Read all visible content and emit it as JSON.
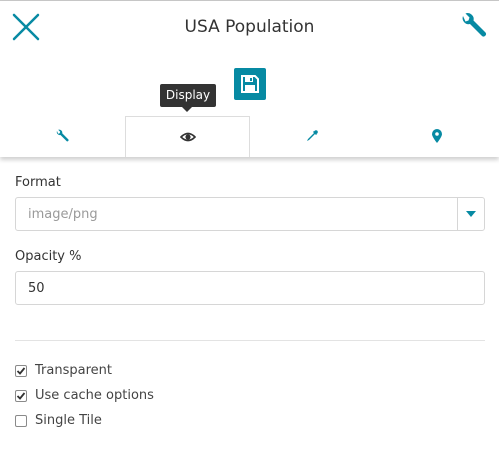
{
  "header": {
    "title": "USA Population",
    "close_icon": "close-icon",
    "settings_icon": "wrench-icon"
  },
  "toolbar": {
    "save_icon": "floppy-disk-icon",
    "tooltip": "Display"
  },
  "tabs": [
    {
      "icon": "wrench-icon",
      "active": false
    },
    {
      "icon": "eye-icon",
      "active": true
    },
    {
      "icon": "eyedropper-icon",
      "active": false
    },
    {
      "icon": "map-marker-icon",
      "active": false
    }
  ],
  "form": {
    "format_label": "Format",
    "format_value": "image/png",
    "opacity_label": "Opacity %",
    "opacity_value": "50"
  },
  "options": [
    {
      "label": "Transparent",
      "checked": true
    },
    {
      "label": "Use cache options",
      "checked": true
    },
    {
      "label": "Single Tile",
      "checked": false
    }
  ],
  "colors": {
    "accent": "#078aa3",
    "tooltip_bg": "#333333",
    "text": "#333333"
  }
}
